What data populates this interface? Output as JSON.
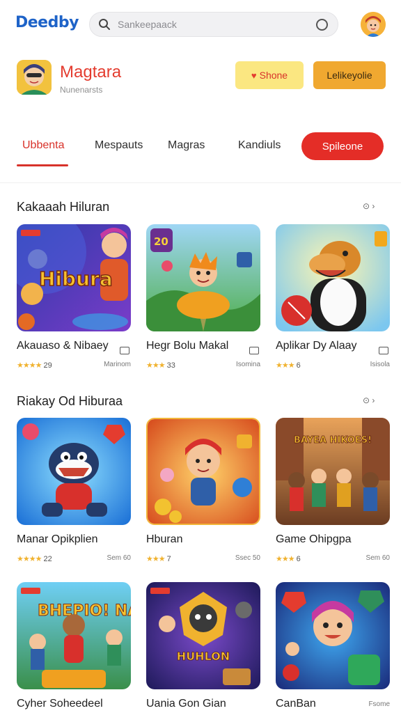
{
  "header": {
    "logo": "Deedby",
    "search_placeholder": "Sankeepaack",
    "icons": [
      "search-icon",
      "circle-icon"
    ]
  },
  "app": {
    "name": "Magtara",
    "subtitle": "Nunenarsts",
    "secondary_button": "Shone",
    "primary_button": "Lelikeyolie"
  },
  "tabs": [
    {
      "label": "Ubbenta",
      "active": true
    },
    {
      "label": "Mespauts",
      "active": false
    },
    {
      "label": "Magras",
      "active": false
    },
    {
      "label": "Kandiuls",
      "active": false
    }
  ],
  "tab_pill": "Spileone",
  "colors": {
    "accent": "#e42d27",
    "brand": "#1e63c8",
    "star": "#f0b22f"
  },
  "sections": [
    {
      "title": "Kakaaah Hiluran",
      "more": "⊙ ›",
      "cards": [
        {
          "title": "Akauaso & Nibaey",
          "stars": "★★★★",
          "rating": "29",
          "meta": "Marinom",
          "thumb_text": "Hibura"
        },
        {
          "title": "Hegr Bolu Makal",
          "stars": "★★★",
          "rating": "33",
          "meta": "Isomina",
          "thumb_text": "20"
        },
        {
          "title": "Aplikar Dy Alaay",
          "stars": "★★★",
          "rating": "6",
          "meta": "Isisola",
          "thumb_text": ""
        }
      ]
    },
    {
      "title": "Riakay Od Hiburaa",
      "more": "⊙ ›",
      "cards": [
        {
          "title": "Manar Opikplien",
          "stars": "★★★★",
          "rating": "22",
          "meta": "Sem 60",
          "thumb_text": ""
        },
        {
          "title": "Hburan",
          "stars": "★★★",
          "rating": "7",
          "meta": "Ssec 50",
          "thumb_text": ""
        },
        {
          "title": "Game Ohipgpa",
          "stars": "★★★",
          "rating": "6",
          "meta": "Sem 60",
          "thumb_text": "BAYEA HIKOES!"
        }
      ]
    },
    {
      "title": "",
      "more": "",
      "cards": [
        {
          "title": "Cyher Soheedeel",
          "stars": "",
          "rating": "",
          "meta": "",
          "thumb_text": "BHEPIO! NAUS"
        },
        {
          "title": "Uania Gon Gian",
          "stars": "",
          "rating": "",
          "meta": "",
          "thumb_text": "HUHLON"
        },
        {
          "title": "CanBan",
          "stars": "",
          "rating": "",
          "meta": "Fsome",
          "thumb_text": ""
        }
      ]
    }
  ]
}
